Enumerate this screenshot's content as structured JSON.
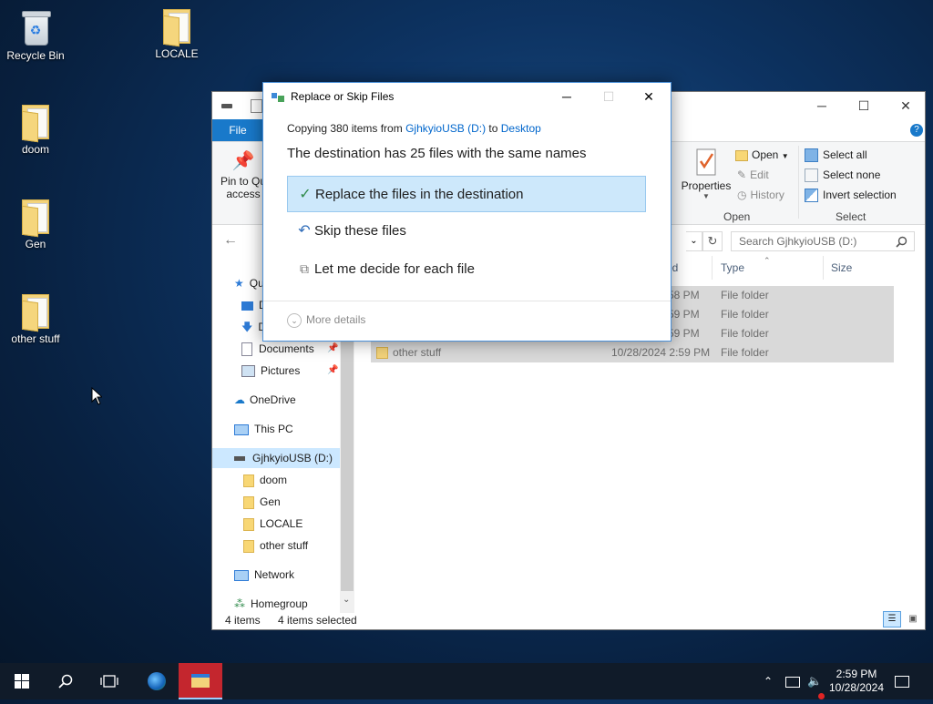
{
  "desktop": {
    "icons": [
      {
        "label": "Recycle Bin"
      },
      {
        "label": "LOCALE"
      },
      {
        "label": "doom"
      },
      {
        "label": "Gen"
      },
      {
        "label": "other stuff"
      }
    ]
  },
  "explorer": {
    "file_tab": "File",
    "ribbon": {
      "pin_line1": "Pin to Qu",
      "pin_line2": "access",
      "properties": "Properties",
      "open": "Open",
      "edit": "Edit",
      "history": "History",
      "open_group": "Open",
      "select_all": "Select all",
      "select_none": "Select none",
      "invert_selection": "Invert selection",
      "select_group": "Select"
    },
    "search_placeholder": "Search GjhkyioUSB (D:)",
    "nav": {
      "quick_access": "Qu",
      "desktop": "D",
      "downloads": "D",
      "documents": "Documents",
      "pictures": "Pictures",
      "onedrive": "OneDrive",
      "this_pc": "This PC",
      "drive": "GjhkyioUSB (D:)",
      "sub": [
        "doom",
        "Gen",
        "LOCALE",
        "other stuff"
      ],
      "network": "Network",
      "homegroup": "Homegroup"
    },
    "columns": {
      "date": "ed",
      "type": "Type",
      "size": "Size"
    },
    "rows": [
      {
        "name": "",
        "date": "58 PM",
        "type": "File folder"
      },
      {
        "name": "",
        "date": "59 PM",
        "type": "File folder"
      },
      {
        "name": "",
        "date": "59 PM",
        "type": "File folder"
      },
      {
        "name": "other stuff",
        "date": "10/28/2024 2:59 PM",
        "type": "File folder"
      }
    ],
    "status_count": "4 items",
    "status_selected": "4 items selected"
  },
  "dialog": {
    "title": "Replace or Skip Files",
    "copy_prefix": "Copying 380 items from ",
    "source": "GjhkyioUSB (D:)",
    "to_word": " to ",
    "destination": "Desktop",
    "heading": "The destination has 25 files with the same names",
    "option_replace": "Replace the files in the destination",
    "option_skip": "Skip these files",
    "option_decide": "Let me decide for each file",
    "more_details": "More details"
  },
  "taskbar": {
    "time": "2:59 PM",
    "date": "10/28/2024"
  },
  "colors": {
    "accent": "#1979ca",
    "highlight": "#cde8fb",
    "link": "#0066cc"
  }
}
